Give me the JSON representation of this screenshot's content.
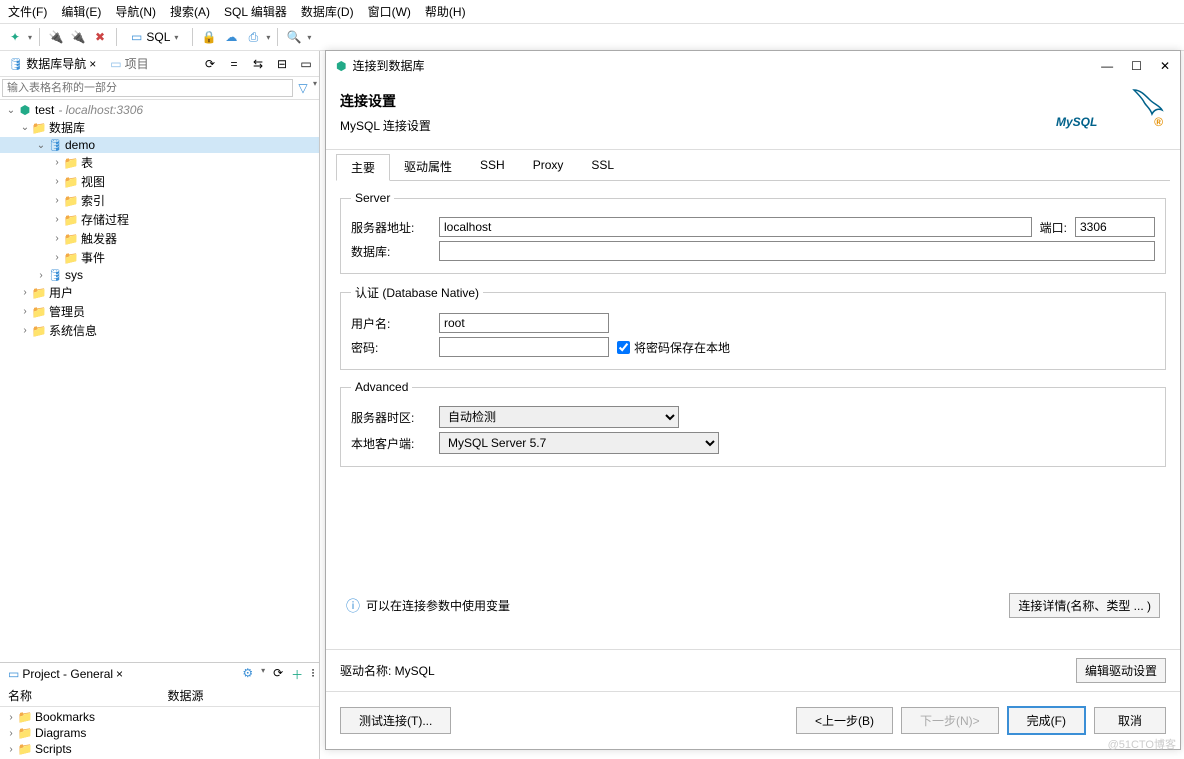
{
  "menu": {
    "file": "文件(F)",
    "edit": "编辑(E)",
    "nav": "导航(N)",
    "search": "搜索(A)",
    "sql": "SQL 编辑器",
    "db": "数据库(D)",
    "window": "窗口(W)",
    "help": "帮助(H)"
  },
  "toolbar": {
    "sql_label": "SQL"
  },
  "nav": {
    "tab1": "数据库导航",
    "tab2": "项目",
    "filter_placeholder": "输入表格名称的一部分"
  },
  "tree": {
    "conn": "test",
    "conn_meta": "- localhost:3306",
    "dbs": "数据库",
    "demo": "demo",
    "tables": "表",
    "views": "视图",
    "indexes": "索引",
    "procs": "存储过程",
    "triggers": "触发器",
    "events": "事件",
    "sys": "sys",
    "users": "用户",
    "admins": "管理员",
    "sysinfo": "系统信息"
  },
  "bottom": {
    "title": "Project - General",
    "col1": "名称",
    "col2": "数据源",
    "bookmarks": "Bookmarks",
    "diagrams": "Diagrams",
    "scripts": "Scripts"
  },
  "dialog": {
    "title": "连接到数据库",
    "heading": "连接设置",
    "sub": "MySQL 连接设置",
    "logo": "MySQL",
    "tabs": {
      "main": "主要",
      "driver": "驱动属性",
      "ssh": "SSH",
      "proxy": "Proxy",
      "ssl": "SSL"
    },
    "server_legend": "Server",
    "host_label": "服务器地址:",
    "host_value": "localhost",
    "port_label": "端口:",
    "port_value": "3306",
    "db_label": "数据库:",
    "db_value": "",
    "auth_legend": "认证 (Database Native)",
    "user_label": "用户名:",
    "user_value": "root",
    "pass_label": "密码:",
    "pass_value": "",
    "save_pass": "将密码保存在本地",
    "adv_legend": "Advanced",
    "tz_label": "服务器时区:",
    "tz_value": "自动检测",
    "client_label": "本地客户端:",
    "client_value": "MySQL Server 5.7",
    "info": "可以在连接参数中使用变量",
    "details_btn": "连接详情(名称、类型 ... )",
    "driver_label": "驱动名称: MySQL",
    "edit_driver": "编辑驱动设置",
    "test": "测试连接(T)...",
    "back": "<上一步(B)",
    "next": "下一步(N)>",
    "finish": "完成(F)",
    "cancel": "取消"
  },
  "watermark": "@51CTO博客"
}
